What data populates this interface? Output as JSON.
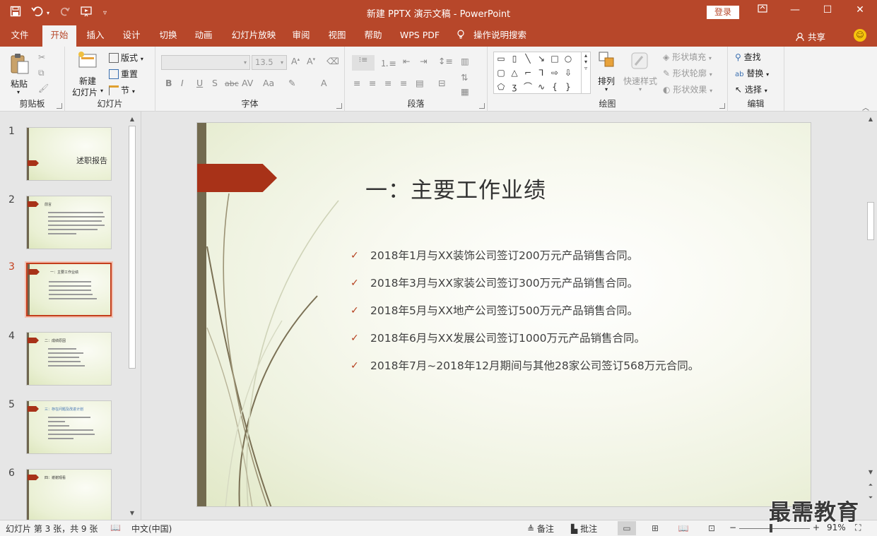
{
  "window": {
    "title": "新建 PPTX 演示文稿 - PowerPoint",
    "login_label": "登录",
    "brand_color": "#b7472a"
  },
  "qat": {
    "icons": [
      "save-icon",
      "undo-icon",
      "redo-icon",
      "slideshow-from-start-icon",
      "customize-qat-icon"
    ]
  },
  "tabs": [
    {
      "label": "文件"
    },
    {
      "label": "开始"
    },
    {
      "label": "插入"
    },
    {
      "label": "设计"
    },
    {
      "label": "切换"
    },
    {
      "label": "动画"
    },
    {
      "label": "幻灯片放映"
    },
    {
      "label": "审阅"
    },
    {
      "label": "视图"
    },
    {
      "label": "帮助"
    },
    {
      "label": "WPS PDF"
    },
    {
      "label": "操作说明搜索"
    }
  ],
  "active_tab": "开始",
  "share_label": "共享",
  "ribbon": {
    "clipboard": {
      "paste": "粘贴",
      "group": "剪贴板"
    },
    "slides": {
      "new_slide": "新建",
      "new_slide_2": "幻灯片",
      "layout": "版式",
      "reset": "重置",
      "section": "节",
      "group": "幻灯片"
    },
    "font": {
      "font_size": "13.5",
      "group": "字体"
    },
    "paragraph": {
      "group": "段落"
    },
    "drawing": {
      "arrange": "排列",
      "quick_styles": "快速样式",
      "shape_fill": "形状填充",
      "shape_outline": "形状轮廓",
      "shape_effects": "形状效果",
      "group": "绘图"
    },
    "editing": {
      "find": "查找",
      "replace": "替换",
      "select": "选择",
      "group": "编辑"
    }
  },
  "thumbnails": [
    {
      "num": "1",
      "title": "述职报告"
    },
    {
      "num": "2",
      "title": "前言"
    },
    {
      "num": "3",
      "title": "一：主要工作业绩"
    },
    {
      "num": "4",
      "title": "二：成绩原因"
    },
    {
      "num": "5",
      "title": "三：存在问题及改进计划"
    },
    {
      "num": "6",
      "title": "四：谢谢观看"
    }
  ],
  "selected_slide": 3,
  "slide": {
    "title": "一：主要工作业绩",
    "bullets": [
      "2018年1月与XX装饰公司签订200万元产品销售合同。",
      "2018年3月与XX家装公司签订300万元产品销售合同。",
      "2018年5月与XX地产公司签订500万元产品销售合同。",
      "2018年6月与XX发展公司签订1000万元产品销售合同。",
      "2018年7月~2018年12月期间与其他28家公司签订568万元合同。"
    ],
    "accent_color": "#a83218"
  },
  "statusbar": {
    "slide_info": "幻灯片 第 3 张，共 9 张",
    "language": "中文(中国)",
    "notes": "备注",
    "comments": "批注",
    "zoom_percent": "91%",
    "zoom_value": 91
  },
  "watermark": "最需教育"
}
